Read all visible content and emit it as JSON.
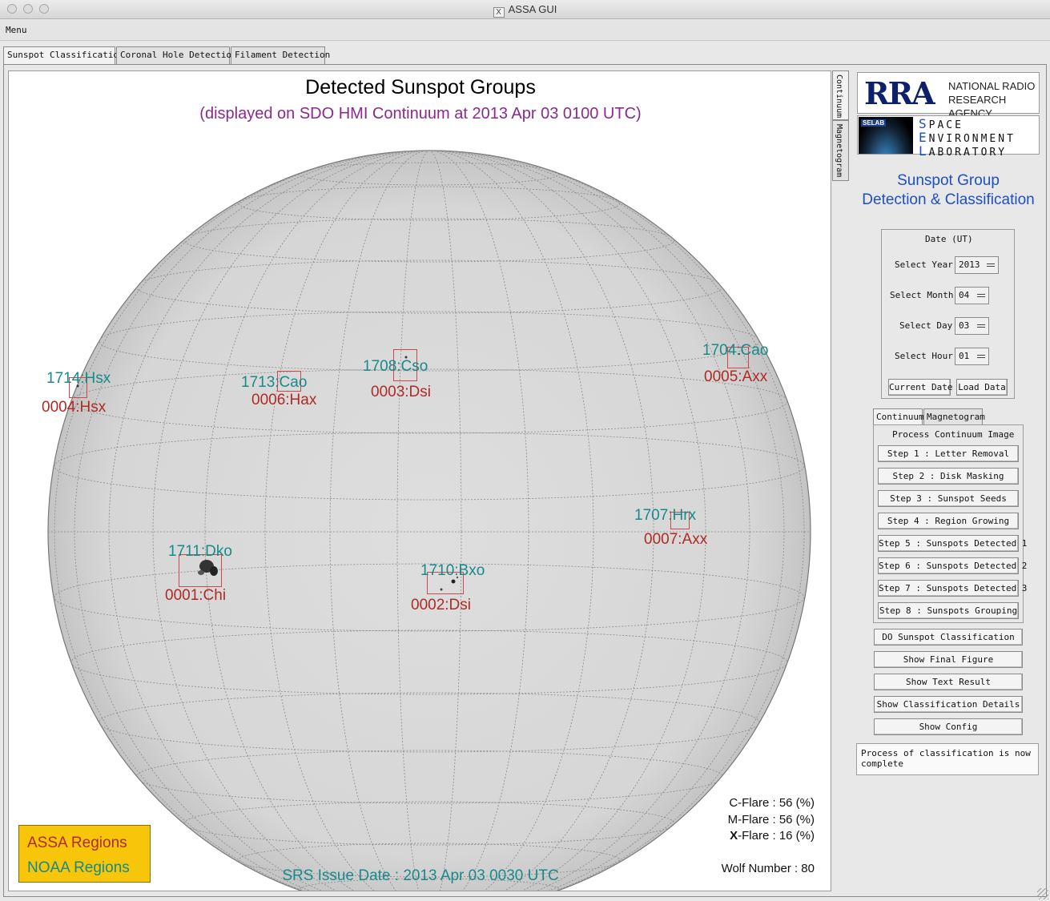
{
  "window": {
    "title": "ASSA GUI",
    "x_icon": "X"
  },
  "menu": {
    "label": "Menu"
  },
  "tabs": [
    "Sunspot Classification",
    "Coronal Hole Detection",
    "Filament Detection"
  ],
  "vertical_tabs": [
    "Continuum",
    "Magnetogram"
  ],
  "display": {
    "title": "Detected Sunspot Groups",
    "subtitle": "(displayed on SDO HMI Continuum at 2013 Apr 03 0100 UTC)",
    "regions": [
      {
        "noaa": "1714:Hsx",
        "assa": "0004:Hsx"
      },
      {
        "noaa": "1713:Cao",
        "assa": "0006:Hax"
      },
      {
        "noaa": "1708:Cso",
        "assa": "0003:Dsi"
      },
      {
        "noaa": "1704:Cao",
        "assa": "0005:Axx"
      },
      {
        "noaa": "1707:Hrx",
        "assa": "0007:Axx"
      },
      {
        "noaa": "1711:Dko",
        "assa": "0001:Chi"
      },
      {
        "noaa": "1710:Bxo",
        "assa": "0002:Dsi"
      }
    ],
    "c_flare_label": "C-Flare : 56 (%)",
    "m_flare_label": "-Flare : 56 (%)",
    "m_flare_letter": "M",
    "x_flare_label": "-Flare : 16 (%)",
    "x_flare_letter": "X",
    "wolf": "Wolf Number : 80",
    "srs": "SRS Issue Date : 2013 Apr 03 0030 UTC",
    "legend_assa": "ASSA Regions",
    "legend_noaa": "NOAA Regions"
  },
  "logos": {
    "rra": "RRA",
    "rra_line1": "NATIONAL RADIO",
    "rra_line2": "RESEARCH AGENCY",
    "selab_tag": "SELAB",
    "sel_line1_initial": "S",
    "sel_line1": "PACE",
    "sel_line2_initial": "E",
    "sel_line2": "NVIRONMENT",
    "sel_line3_initial": "L",
    "sel_line3": "ABORATORY"
  },
  "side_title_1": "Sunspot Group",
  "side_title_2": "Detection & Classification",
  "date_panel": {
    "title": "Date (UT)",
    "year_label": "Select Year",
    "year": "2013",
    "month_label": "Select Month",
    "month": "04",
    "day_label": "Select Day",
    "day": "03",
    "hour_label": "Select Hour",
    "hour": "01",
    "current_date": "Current Date",
    "load_data": "Load Data"
  },
  "sub_tabs": [
    "Continuum",
    "Magnetogram"
  ],
  "process": {
    "title": "Process Continuum Image",
    "steps": [
      "Step 1 : Letter Removal",
      "Step 2 : Disk Masking",
      "Step 3 : Sunspot Seeds",
      "Step 4 : Region Growing",
      "Step 5 : Sunspots Detected 1",
      "Step 6 : Sunspots Detected 2",
      "Step 7 : Sunspots Detected 3",
      "Step 8 : Sunspots Grouping"
    ]
  },
  "actions": [
    "DO Sunspot Classification",
    "Show Final Figure",
    "Show Text Result",
    "Show Classification Details",
    "Show Config"
  ],
  "status": "Process of classification is now complete",
  "colors": {
    "noaa": "#178a8a",
    "assa": "#b02a24",
    "subtitle": "#8b2a8e",
    "legend_bg": "#f7c60a",
    "side_title": "#1d4fc4"
  }
}
